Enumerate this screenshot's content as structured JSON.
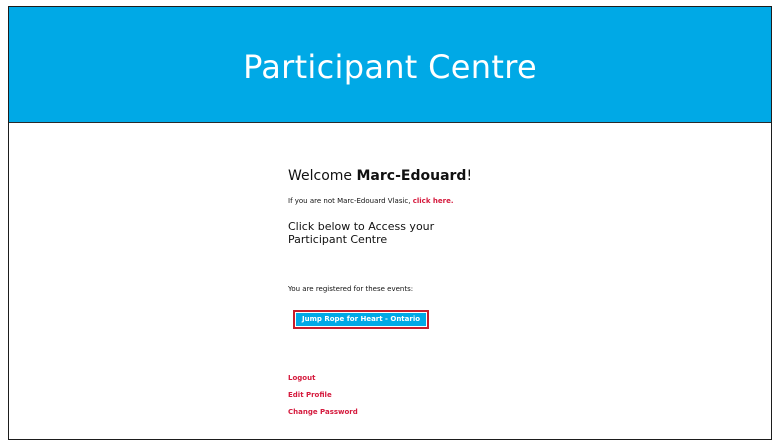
{
  "colors": {
    "header_bg": "#00a9e6",
    "link": "#d51a3d",
    "button_bg": "#00a9e6",
    "button_outline": "#c81d2b"
  },
  "header": {
    "title": "Participant Centre"
  },
  "welcome": {
    "prefix": "Welcome ",
    "name": "Marc-Edouard",
    "suffix": "!"
  },
  "not_you": {
    "text": "If you are not Marc-Edouard Vlasic, ",
    "link_label": "click here."
  },
  "access_text": "Click below to Access your Participant Centre",
  "registered_text": "You are registered for these events:",
  "events": [
    {
      "label": "Jump Rope for Heart - Ontario"
    }
  ],
  "links": {
    "logout": "Logout",
    "edit_profile": "Edit Profile",
    "change_password": "Change Password"
  }
}
